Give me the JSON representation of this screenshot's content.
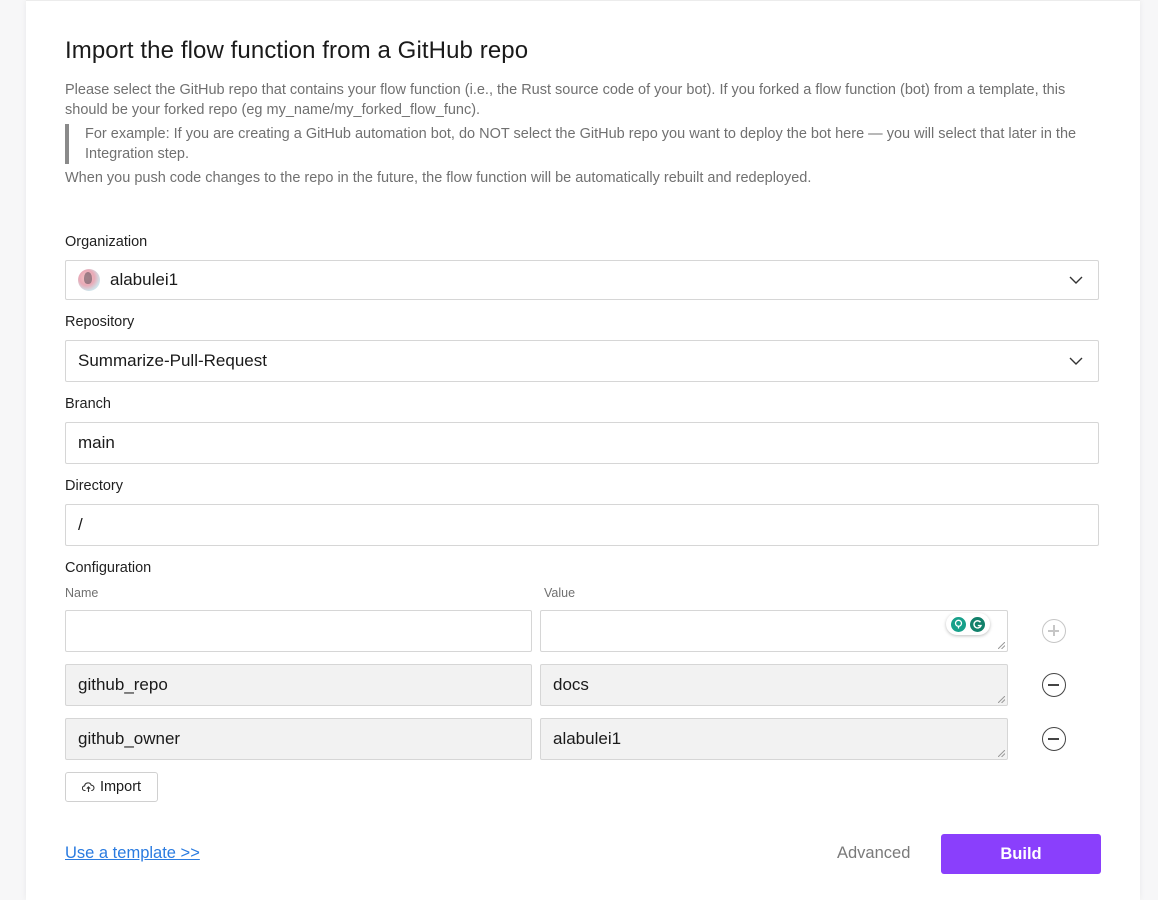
{
  "page": {
    "title": "Import the flow function from a GitHub repo",
    "description": "Please select the GitHub repo that contains your flow function (i.e., the Rust source code of your bot). If you forked a flow function (bot) from a template, this should be your forked repo (eg my_name/my_forked_flow_func).",
    "note": "For example: If you are creating a GitHub automation bot, do NOT select the GitHub repo you want to deploy the bot here — you will select that later in the Integration step.",
    "description2": "When you push code changes to the repo in the future, the flow function will be automatically rebuilt and redeployed."
  },
  "form": {
    "organization": {
      "label": "Organization",
      "value": "alabulei1",
      "icon": "avatar"
    },
    "repository": {
      "label": "Repository",
      "value": "Summarize-Pull-Request"
    },
    "branch": {
      "label": "Branch",
      "value": "main"
    },
    "directory": {
      "label": "Directory",
      "value": "/"
    }
  },
  "configuration": {
    "label": "Configuration",
    "name_header": "Name",
    "value_header": "Value",
    "rows": [
      {
        "name": "github_repo",
        "value": "docs"
      },
      {
        "name": "github_owner",
        "value": "alabulei1"
      }
    ],
    "import_label": "Import"
  },
  "footer": {
    "template_link": "Use a template >>",
    "advanced_label": "Advanced",
    "build_label": "Build"
  },
  "colors": {
    "accent": "#8a3ffc",
    "link": "#2a7be0",
    "grammarly_bulb": "#17a08a",
    "grammarly_g": "#11806a"
  }
}
